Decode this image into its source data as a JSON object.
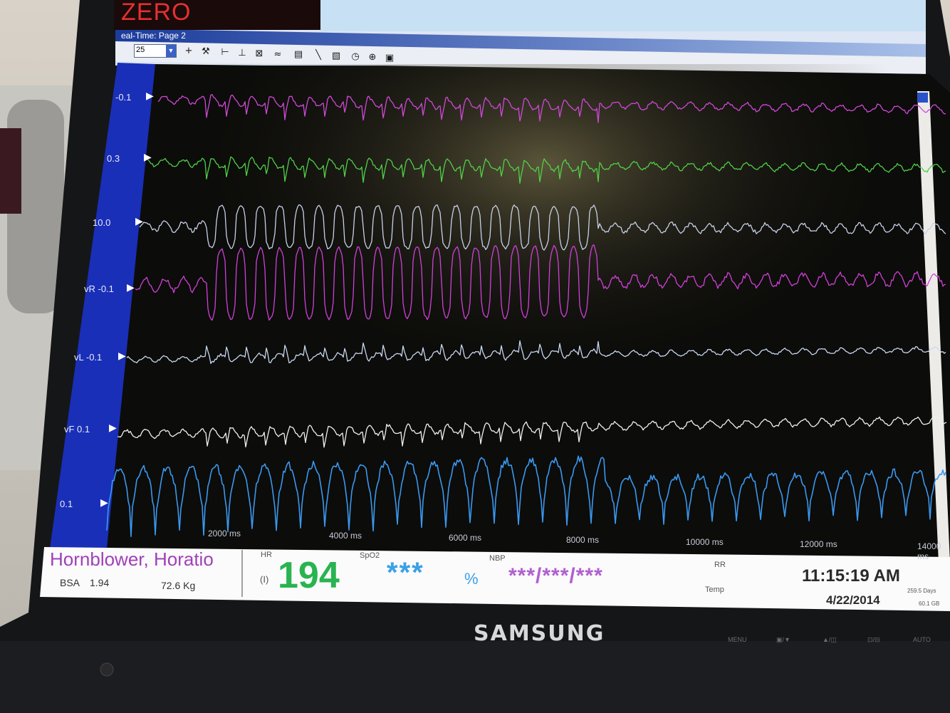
{
  "app": {
    "title_fragment": "ZERO",
    "window_title": "eal-Time: Page 2",
    "zoom_select_value": "25"
  },
  "toolbar": {
    "icons": [
      "plus-icon",
      "tools-icon",
      "measure-horizontal-icon",
      "measure-vertical-icon",
      "grid-icon",
      "wave-icon",
      "print-icon",
      "ruler-icon",
      "ruler-alt-icon",
      "clock-icon",
      "target-icon",
      "camera-icon"
    ],
    "glyphs": [
      "+",
      "⚒",
      "⊢",
      "⊥",
      "⊠",
      "≈",
      "▤",
      "╲",
      "▧",
      "◷",
      "⊕",
      "▣"
    ]
  },
  "channels": [
    {
      "label": "-0.1",
      "color": "#d048d8",
      "kind": "ecg"
    },
    {
      "label": "0.3",
      "color": "#50d048",
      "kind": "ecg"
    },
    {
      "label": "10.0",
      "color": "#c8d0e8",
      "kind": "ecg"
    },
    {
      "label": "vR -0.1",
      "color": "#d040d8",
      "kind": "ecg"
    },
    {
      "label": "vL -0.1",
      "color": "#c8d8f0",
      "kind": "ecg"
    },
    {
      "label": "vF 0.1",
      "color": "#f0f0f0",
      "kind": "ecg"
    },
    {
      "label": "0.1",
      "color": "#3a98f0",
      "kind": "pressure"
    }
  ],
  "time_axis": [
    "2000 ms",
    "4000 ms",
    "6000 ms",
    "8000 ms",
    "10000 ms",
    "12000 ms",
    "14000 ms"
  ],
  "status": {
    "patient_name": "Hornblower, Horatio",
    "bsa_label": "BSA",
    "bsa_value": "1.94",
    "weight": "72.6 Kg",
    "hr_label": "HR",
    "hr_source": "(I)",
    "hr_value": "194",
    "spo2_label": "SpO2",
    "spo2_value": "***",
    "spo2_unit": "%",
    "nbp_label": "NBP",
    "nbp_value": "***/***/***",
    "rr_label": "RR",
    "temp_label": "Temp",
    "time": "11:15:19 AM",
    "date": "4/22/2014",
    "storage_days": "259.5 Days",
    "storage_size": "60.1 GB"
  },
  "monitor": {
    "brand": "SAMSUNG",
    "buttons": [
      "MENU",
      "▣/▼",
      "▲/◫",
      "⊡/⊟",
      "AUTO"
    ]
  }
}
